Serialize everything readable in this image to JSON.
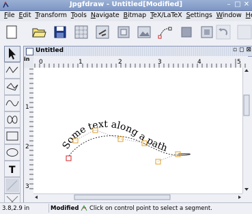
{
  "window": {
    "title": "Jpgfdraw - Untitled[Modified]"
  },
  "menu": [
    "File",
    "Edit",
    "Transform",
    "Tools",
    "Navigate",
    "Bitmap",
    "TeX/LaTeX",
    "Settings",
    "Window",
    "Help"
  ],
  "toolbar": [
    "new-icon",
    "open-icon",
    "save-icon",
    "grid-icon",
    "grid-lock-icon",
    "display-settings-icon",
    "image-icon",
    "path-edit-icon",
    "zoom-icon",
    "select-all-icon",
    "undo-icon",
    "redo-icon"
  ],
  "tools": [
    "select-icon",
    "open-line-icon",
    "closed-line-icon",
    "open-curve-icon",
    "closed-curve-icon",
    "rectangle-icon",
    "ellipse-icon",
    "text-icon",
    "math-text-icon",
    "construction-icon"
  ],
  "document": {
    "title": "Untitled",
    "controls": [
      "restore-icon",
      "maximize-icon",
      "close-icon"
    ]
  },
  "rulers": {
    "unit": "in",
    "h_labels": [
      "0",
      "1",
      "2",
      "3",
      "4",
      "5"
    ],
    "v_labels": [
      "1",
      "2",
      "3"
    ]
  },
  "canvas": {
    "text_on_path": "Some text along a path"
  },
  "status": {
    "coords": "3.8,2.9 in",
    "modified": "Modified",
    "message": "Click on control point to select a segment."
  },
  "colors": {
    "titlebar": "#8aa2cc",
    "path": "#000000",
    "control_point": "#e8a020",
    "selected_point": "#d02020"
  }
}
